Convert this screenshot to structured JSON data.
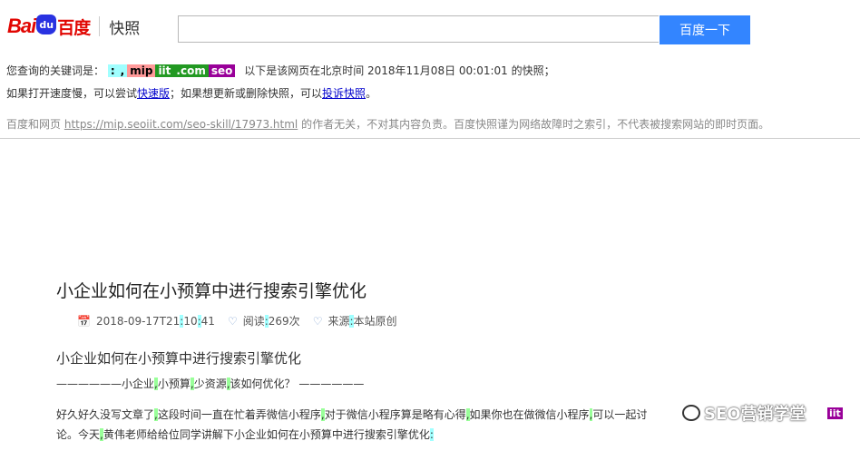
{
  "header": {
    "logo": {
      "part1": "Bai",
      "paw": "du",
      "part2": "百度",
      "product": "快照"
    },
    "search": {
      "value": "",
      "button_label": "百度一下"
    }
  },
  "snapshot_notice": {
    "keywords_prefix": "您查询的关键词是：",
    "keywords": [
      ":",
      ",",
      "mip",
      "iit",
      ".com",
      "seo"
    ],
    "time_text": "以下是该网页在北京时间 2018年11月08日 00:01:01 的快照；",
    "line2_a": "如果打开速度慢，可以尝试",
    "fast_link": "快速版",
    "line2_b": "；如果想更新或删除快照，可以",
    "complain_link": "投诉快照",
    "line2_end": "。"
  },
  "disclaimer": {
    "prefix": "百度和网页",
    "url": "https://mip.seoiit.com/seo-skill/17973.html",
    "suffix": "的作者无关，不对其内容负责。百度快照谨为网络故障时之索引，不代表被搜索网站的即时页面。"
  },
  "article": {
    "title": "小企业如何在小预算中进行搜索引擎优化",
    "meta": {
      "date_a": "2018-09-17T21",
      "c1": ":",
      "date_b": "10",
      "c2": ":",
      "date_c": "41",
      "reads_label": "阅读",
      "c3": ":",
      "reads": "269次",
      "source_label": "来源",
      "c4": ":",
      "source": "本站原创"
    },
    "subtitle": "小企业如何在小预算中进行搜索引擎优化",
    "divider_line": {
      "dash_left": "——————",
      "s1": "小企业",
      "p1": ",",
      "s2": "小预算",
      "p2": ",",
      "s3": "少资源",
      "p3": ",",
      "s4": "该如何优化？",
      "dash_right": " ——————"
    },
    "para1": {
      "a": "好久好久没写文章了",
      "p1": ",",
      "b": "这段时间一直在忙着弄微信小程序",
      "p2": ",",
      "c": "对于微信小程序算是略有心得",
      "p3": ",",
      "d": "如果你也在做微信小程序",
      "p4": ",",
      "e": "可以一起讨"
    },
    "para2": {
      "a": "论。今天",
      "p1": ",",
      "b": "黄伟老师给给位同学讲解下小企业如何在小预算中进行搜索引擎优化",
      "c1": ":"
    }
  },
  "watermark": {
    "text": "SEO营销学堂",
    "badge": "iit"
  }
}
